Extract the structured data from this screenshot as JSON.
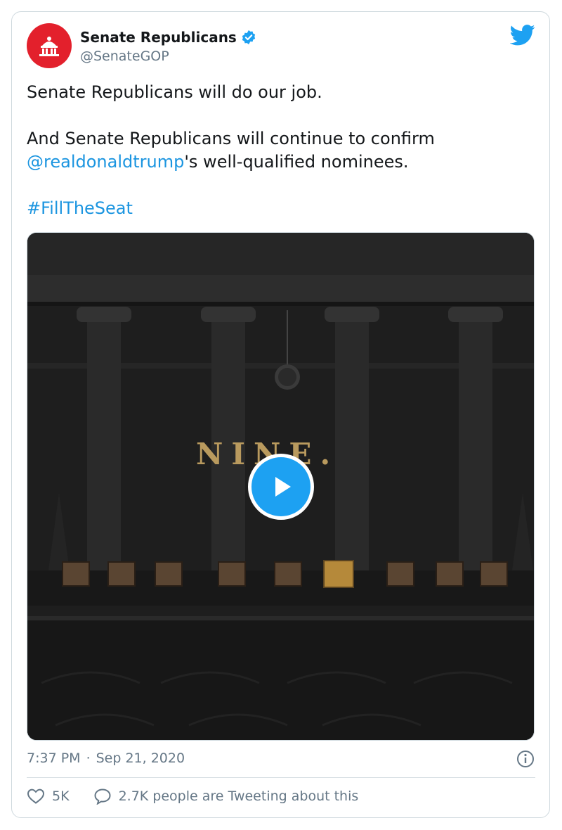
{
  "tweet": {
    "author_name": "Senate Republicans",
    "author_handle": "@SenateGOP",
    "verified": true,
    "text_line1": "Senate Republicans will do our job.",
    "text_line2": "And Senate Republicans will continue to confirm",
    "mention": "@realdonaldtrump",
    "text_line3_rest": "'s well-qualified nominees.",
    "hashtag": "#FillTheSeat",
    "time": "7:37 PM",
    "separator": "·",
    "date": "Sep 21, 2020",
    "likes": "5K",
    "tweeting_text": "2.7K people are Tweeting about this"
  },
  "media": {
    "overlay_text": "NINE.",
    "type": "video"
  },
  "icons": {
    "platform": "twitter-bird-icon",
    "verified": "verified-badge-icon",
    "play": "play-icon",
    "info": "info-icon",
    "like": "heart-icon",
    "reply": "comment-icon"
  },
  "colors": {
    "brand": "#1da1f2",
    "link": "#1b95e0",
    "avatar_bg": "#e3202c",
    "muted": "#657786"
  }
}
